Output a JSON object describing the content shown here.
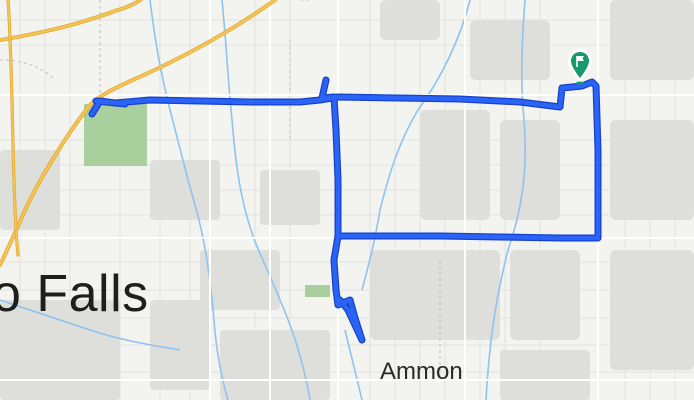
{
  "map": {
    "labels": {
      "city": "o Falls",
      "town": "Ammon"
    },
    "route": {
      "color": "#2a63f6",
      "outline_color": "#1741c8"
    },
    "colors": {
      "background": "#f3f3f0",
      "road_major": "#f5c451",
      "road_major_outline": "#e0a93a",
      "road_minor": "#ffffff",
      "road_grid": "#e4e4e0",
      "park": "#a9cf9c",
      "water": "#8fc3ef",
      "building": "#dcdcd8",
      "boundary": "#c8c8c4"
    },
    "marker": {
      "icon": "flag-pin-icon",
      "color": "#179a6a"
    }
  }
}
